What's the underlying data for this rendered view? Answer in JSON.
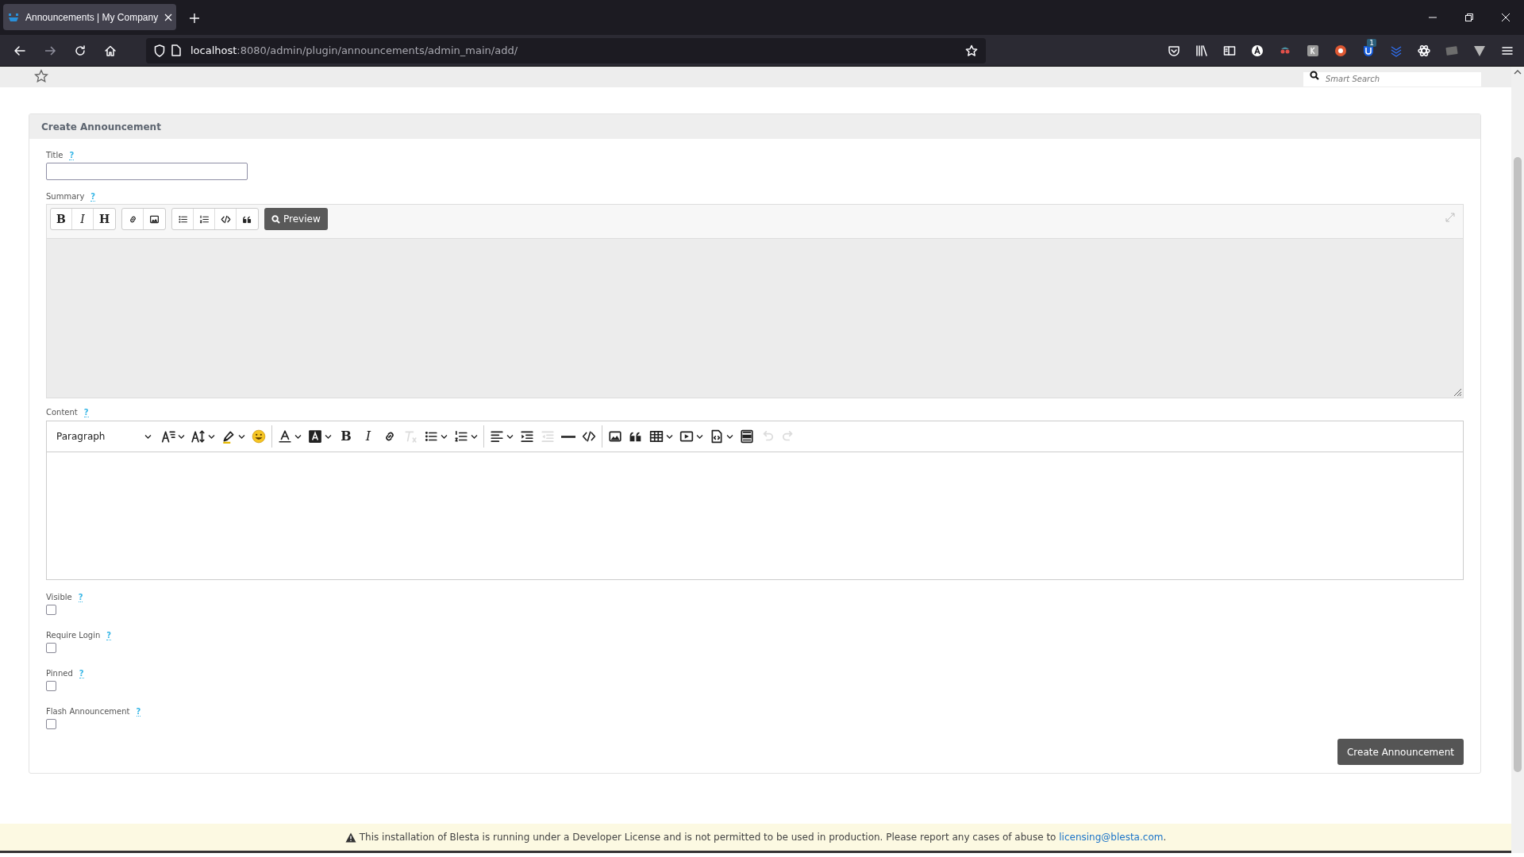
{
  "browser": {
    "tab_title": "Announcements | My Company",
    "url_host": "localhost",
    "url_path": ":8080/admin/plugin/announcements/admin_main/add/",
    "extension_badge": "1"
  },
  "page_header": {
    "search_placeholder": "Smart Search"
  },
  "card": {
    "title": "Create Announcement",
    "title_field": {
      "label": "Title",
      "help": "?"
    },
    "summary": {
      "label": "Summary",
      "help": "?",
      "toolbar_groups": [
        [
          {
            "kind": "bold",
            "label": "B"
          },
          {
            "kind": "italic",
            "label": "I"
          },
          {
            "kind": "heading",
            "label": "H"
          }
        ],
        [
          {
            "kind": "link"
          },
          {
            "kind": "image"
          }
        ],
        [
          {
            "kind": "bullets"
          },
          {
            "kind": "numbers"
          },
          {
            "kind": "code"
          },
          {
            "kind": "quote"
          }
        ]
      ],
      "preview_label": "Preview"
    },
    "content": {
      "label": "Content",
      "help": "?",
      "block_format": "Paragraph",
      "toolbar": [
        {
          "kind": "fontsize",
          "disabled": false
        },
        {
          "kind": "lineheight",
          "disabled": false
        },
        {
          "kind": "highlight",
          "disabled": false
        },
        {
          "kind": "emoji",
          "disabled": false
        },
        {
          "kind": "fontcolor",
          "disabled": false
        },
        {
          "kind": "bgcolor",
          "disabled": false
        },
        {
          "kind": "bold",
          "label": "B",
          "disabled": false
        },
        {
          "kind": "italic",
          "label": "I",
          "disabled": false
        },
        {
          "kind": "link",
          "disabled": false
        },
        {
          "kind": "clear",
          "disabled": true
        },
        {
          "kind": "bullets",
          "disabled": false
        },
        {
          "kind": "numbers",
          "disabled": false
        },
        {
          "kind": "align",
          "disabled": false
        },
        {
          "kind": "indent",
          "disabled": false
        },
        {
          "kind": "outdent",
          "disabled": true
        },
        {
          "kind": "hr",
          "disabled": false
        },
        {
          "kind": "code",
          "disabled": false
        },
        {
          "kind": "image",
          "disabled": false
        },
        {
          "kind": "quote",
          "disabled": false
        },
        {
          "kind": "table",
          "disabled": false
        },
        {
          "kind": "media",
          "disabled": false
        },
        {
          "kind": "template",
          "disabled": false
        },
        {
          "kind": "html",
          "disabled": false
        },
        {
          "kind": "undo",
          "disabled": true
        },
        {
          "kind": "redo",
          "disabled": true
        }
      ]
    },
    "options": [
      {
        "label": "Visible",
        "help": "?",
        "checked": false
      },
      {
        "label": "Require Login",
        "help": "?",
        "checked": false
      },
      {
        "label": "Pinned",
        "help": "?",
        "checked": false
      },
      {
        "label": "Flash Announcement",
        "help": "?",
        "checked": false
      }
    ],
    "submit_label": "Create Announcement"
  },
  "footer": {
    "text": "This installation of Blesta is running under a Developer License and is not permitted to be used in production. Please report any cases of abuse to ",
    "link": "licensing@blesta.com",
    "text_after": "."
  }
}
